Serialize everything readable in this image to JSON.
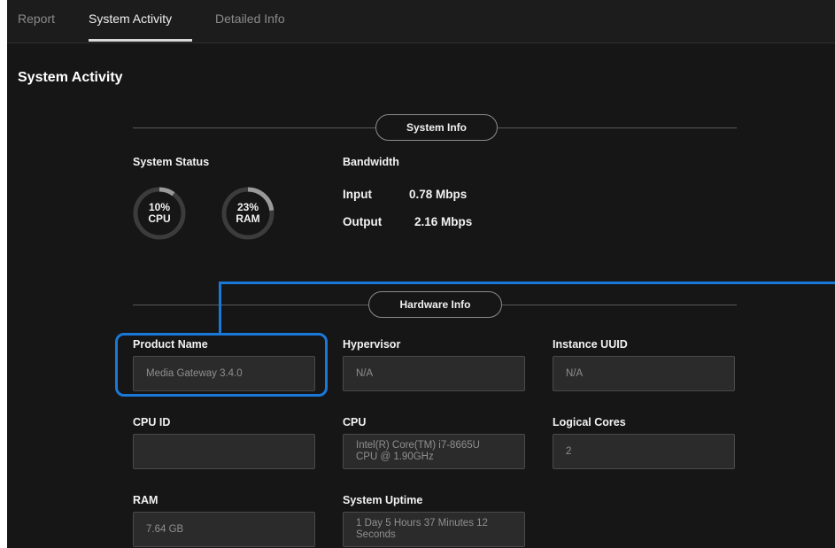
{
  "tabs": [
    {
      "label": "Report",
      "active": false
    },
    {
      "label": "System Activity",
      "active": true
    },
    {
      "label": "Detailed Info",
      "active": false
    }
  ],
  "page_title": "System Activity",
  "system_info": {
    "section_label": "System Info",
    "status_label": "System Status",
    "cpu": {
      "value": "10%",
      "label": "CPU",
      "fraction": 0.1
    },
    "ram": {
      "value": "23%",
      "label": "RAM",
      "fraction": 0.23
    },
    "bandwidth_label": "Bandwidth",
    "input_label": "Input",
    "input_value": "0.78 Mbps",
    "output_label": "Output",
    "output_value": "2.16 Mbps"
  },
  "hardware_info": {
    "section_label": "Hardware Info",
    "fields": {
      "product_name": {
        "label": "Product Name",
        "value": "Media Gateway 3.4.0"
      },
      "hypervisor": {
        "label": "Hypervisor",
        "value": "N/A"
      },
      "instance_uuid": {
        "label": "Instance UUID",
        "value": "N/A"
      },
      "cpu_id": {
        "label": "CPU ID",
        "value": ""
      },
      "cpu": {
        "label": "CPU",
        "value_line1": "Intel(R) Core(TM) i7-8665U",
        "value_line2": "CPU @ 1.90GHz"
      },
      "logical_cores": {
        "label": "Logical Cores",
        "value": "2"
      },
      "ram": {
        "label": "RAM",
        "value": "7.64 GB"
      },
      "system_uptime": {
        "label": "System Uptime",
        "value_line1": "1 Day 5 Hours 37 Minutes 12",
        "value_line2": "Seconds"
      }
    }
  },
  "colors": {
    "background": "#161616",
    "highlight": "#1a78d8",
    "gauge_track": "#3c3c3c",
    "gauge_fill": "#9a9a9a"
  }
}
